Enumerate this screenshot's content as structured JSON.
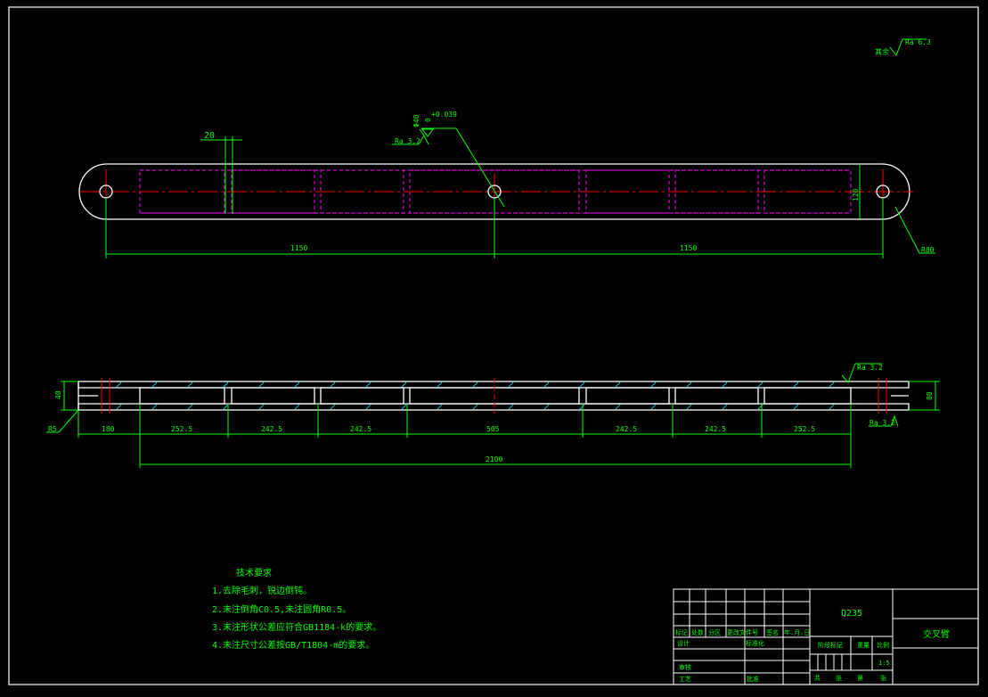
{
  "colors": {
    "background": "#000000",
    "outline": "#ffffff",
    "dimension": "#00ff00",
    "centerline": "#ff0000",
    "hidden": "#ff00ff",
    "hatch": "#00ffff"
  },
  "top_view": {
    "roughness_general": "Ra 6.3",
    "roughness_general_label": "其余",
    "hole_diameter": "Φ40",
    "hole_tolerance_upper": "+0.039",
    "hole_tolerance_lower": "0",
    "hole_roughness": "Ra 3.2",
    "dim_20": "20",
    "dim_120": "120",
    "dim_left_span": "1150",
    "dim_right_span": "1150",
    "end_radius": "R80"
  },
  "front_view": {
    "roughness_top": "Ra 3.2",
    "roughness_bottom": "Ra 3.2",
    "dim_thickness": "40",
    "dim_height": "80",
    "dim_r5": "R5",
    "segment_dims": [
      "180",
      "252.5",
      "242.5",
      "242.5",
      "505",
      "242.5",
      "242.5",
      "252.5"
    ],
    "overall_length": "2100"
  },
  "notes": {
    "title": "技术要求",
    "items": [
      "1.去除毛刺，锐边倒钝。",
      "2.未注倒角C0.5,未注圆角R0.5。",
      "3.未注形状公差应符合GB1184-k的要求。",
      "4.未注尺寸公差按GB/T1804-m的要求。"
    ]
  },
  "title_block": {
    "material": "Q235",
    "part_name": "交叉臂",
    "scale": "1:5",
    "row_labels": [
      "标记",
      "处数",
      "分区",
      "更改文件号",
      "签名",
      "年.月.日"
    ],
    "design": "设计",
    "standardization": "标准化",
    "stage_mark": "阶段标记",
    "weight": "重量",
    "scale_label": "比例",
    "review": "审核",
    "process": "工艺",
    "approve": "批准",
    "sheets": [
      "共",
      "张",
      "第",
      "张"
    ]
  }
}
